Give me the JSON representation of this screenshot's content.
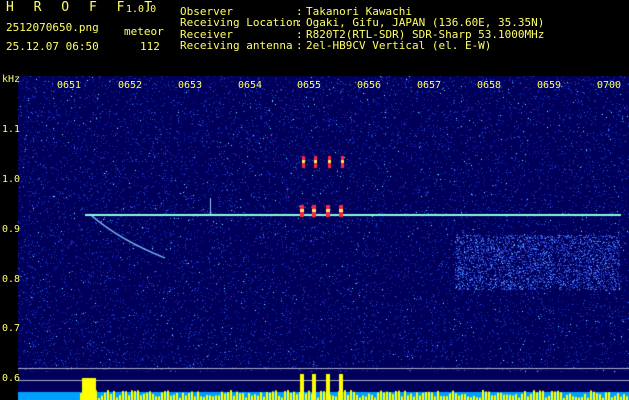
{
  "app": {
    "name": "H R O F F T",
    "version": "1.0.0"
  },
  "file": {
    "name": "2512070650.png",
    "datetime": "25.12.07 06:50"
  },
  "meteor": {
    "label": "meteor",
    "count": "112"
  },
  "info": [
    {
      "label": "Observer",
      "sep": ":",
      "value": "Takanori Kawachi"
    },
    {
      "label": "Receiving Location",
      "sep": ":",
      "value": "Ogaki, Gifu, JAPAN (136.60E, 35.35N)"
    },
    {
      "label": "Receiver",
      "sep": ":",
      "value": "R820T2(RTL-SDR) SDR-Sharp 53.1000MHz"
    },
    {
      "label": "Receiving antenna",
      "sep": ":",
      "value": "2el-HB9CV Vertical (el. E-W)"
    }
  ],
  "axis": {
    "y_unit": "kHz",
    "freq_ticks": [
      "1.1",
      "1.0",
      "0.9",
      "0.8",
      "0.7",
      "0.6"
    ],
    "time_ticks": [
      "0651",
      "0652",
      "0653",
      "0654",
      "0655",
      "0656",
      "0657",
      "0658",
      "0659",
      "0700"
    ]
  },
  "colors": {
    "text": "#ffff66",
    "background": "#00005a",
    "carrier": "#88ffdd",
    "counter_bar": "#ffff00",
    "signal_hot": "#ff2244"
  }
}
